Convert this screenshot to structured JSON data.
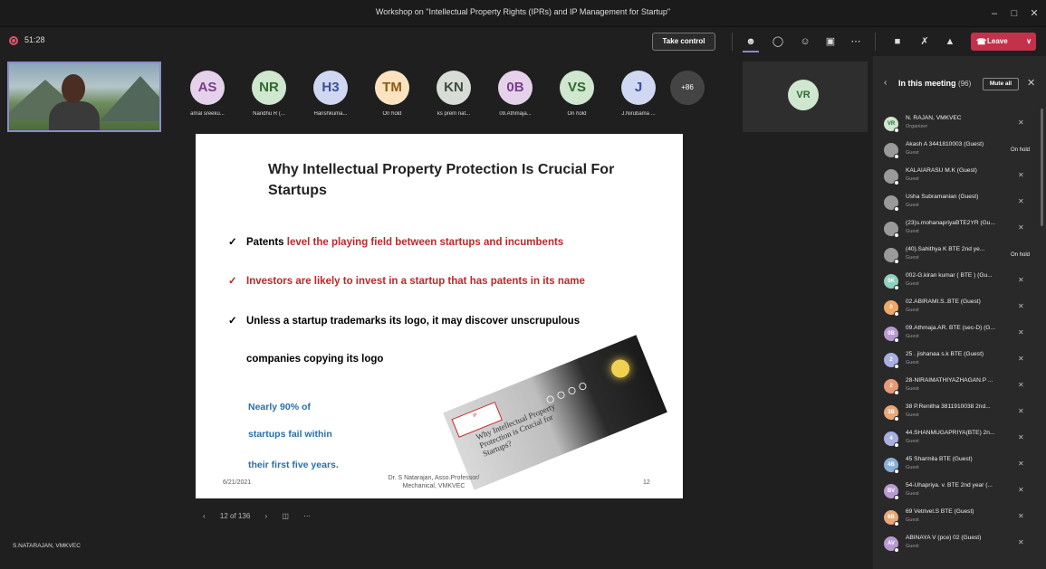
{
  "window": {
    "title": "Workshop on \"Intellectual Property Rights (IPRs) and IP Management for Startup\""
  },
  "toolbar": {
    "timer": "51:28",
    "take_control_label": "Take control",
    "leave_label": "Leave"
  },
  "participants_strip": [
    {
      "initials": "AS",
      "name": "amal sreeku...",
      "bg": "#e5d2ea",
      "fg": "#7a3d8c"
    },
    {
      "initials": "NR",
      "name": "Nandhu R (...",
      "bg": "#cfe6cf",
      "fg": "#2f6a2f"
    },
    {
      "initials": "H3",
      "name": "Harishkuma...",
      "bg": "#cfd8f0",
      "fg": "#3b4f9a"
    },
    {
      "initials": "TM",
      "name": "On hold",
      "bg": "#fbe3c0",
      "fg": "#8a5a12"
    },
    {
      "initials": "KN",
      "name": "ks prem nat...",
      "bg": "#d7dcd7",
      "fg": "#3d4a3d"
    },
    {
      "initials": "0B",
      "name": "09.Athmaja...",
      "bg": "#e5d2ea",
      "fg": "#7a3d8c"
    },
    {
      "initials": "VS",
      "name": "On hold",
      "bg": "#cfe6cf",
      "fg": "#2f6a2f"
    },
    {
      "initials": "J",
      "name": "J.Nirubama ...",
      "bg": "#cfd8f0",
      "fg": "#3b4f9a"
    }
  ],
  "more_count": "+86",
  "vr_tile": {
    "initials": "VR"
  },
  "slide": {
    "title": "Why Intellectual Property Protection Is Crucial For Startups",
    "bullet1_black": "Patents ",
    "bullet1_red": "level the playing field between startups and incumbents",
    "bullet2": "Investors are likely to invest in a startup that has patents in its name",
    "bullet3_line1": "Unless a startup trademarks its logo, it may discover unscrupulous",
    "bullet3_line2": "companies copying its logo",
    "stat_line1": "Nearly 90% of",
    "stat_line2": "startups fail within",
    "stat_line3": "their first five years.",
    "image_text": "Why Intellectual Property Protection is Crucial for Startups?",
    "date": "6/21/2021",
    "footer": "Dr. S Natarajan, Asso.Professor/ Mechanical, VMKVEC",
    "page_number": "12"
  },
  "pager": {
    "text": "12 of 136"
  },
  "presenter_name": "S.NATARAJAN, VMKVEC",
  "panel": {
    "title": "In this meeting",
    "count": "(96)",
    "mute_all_label": "Mute all",
    "people": [
      {
        "initials": "VR",
        "name": "N. RAJAN, VMKVEC",
        "role": "Organizer",
        "bg": "#cfe6cf",
        "fg": "#2f6a2f",
        "status": "mic"
      },
      {
        "initials": "",
        "name": "Akash A 3441810003 (Guest)",
        "role": "Guest",
        "bg": "#9a9a9a",
        "fg": "#fff",
        "status": "On hold"
      },
      {
        "initials": "",
        "name": "KALAIARASU M.K (Guest)",
        "role": "Guest",
        "bg": "#9a9a9a",
        "fg": "#fff",
        "status": "mic"
      },
      {
        "initials": "",
        "name": "Usha Subramanian (Guest)",
        "role": "Guest",
        "bg": "#9a9a9a",
        "fg": "#fff",
        "status": "mic"
      },
      {
        "initials": "",
        "name": "(23)s.mohanapriyaBTE2YR (Gu...",
        "role": "Guest",
        "bg": "#9a9a9a",
        "fg": "#fff",
        "status": "mic"
      },
      {
        "initials": "",
        "name": "(40).Sahithya K BTE 2nd ye...",
        "role": "Guest",
        "bg": "#9a9a9a",
        "fg": "#fff",
        "status": "On hold"
      },
      {
        "initials": "0K",
        "name": "002-G.kiran kumar ( BTE ) (Gu...",
        "role": "Guest",
        "bg": "#8fd0c0",
        "fg": "#fff",
        "status": "mic"
      },
      {
        "initials": "0",
        "name": "02.ABIRAMI.S..BTE (Guest)",
        "role": "Guest",
        "bg": "#f0a868",
        "fg": "#fff",
        "status": "mic"
      },
      {
        "initials": "0B",
        "name": "09.Athmaja.AR. BTE (sec-D) (G...",
        "role": "Guest",
        "bg": "#b89ad0",
        "fg": "#fff",
        "status": "mic"
      },
      {
        "initials": "2",
        "name": "25 . jishanaa s.k BTE (Guest)",
        "role": "Guest",
        "bg": "#a8b0e0",
        "fg": "#fff",
        "status": "mic"
      },
      {
        "initials": "2",
        "name": "28-NIRAIMATHIYAZHAGAN.P ...",
        "role": "Guest",
        "bg": "#e89a78",
        "fg": "#fff",
        "status": "mic"
      },
      {
        "initials": "3B",
        "name": "38 P.Renitha 3811910038 2nd...",
        "role": "Guest",
        "bg": "#e8a878",
        "fg": "#fff",
        "status": "mic"
      },
      {
        "initials": "4",
        "name": "44.SHANMUGAPRIYA(BTE) 2n...",
        "role": "Guest",
        "bg": "#a8b0e0",
        "fg": "#fff",
        "status": "mic"
      },
      {
        "initials": "4B",
        "name": "45 Sharmila BTE (Guest)",
        "role": "Guest",
        "bg": "#8ab0d8",
        "fg": "#fff",
        "status": "mic"
      },
      {
        "initials": "BV",
        "name": "54-Uhapriya. v. BTE 2nd year (...",
        "role": "Guest",
        "bg": "#b89ad0",
        "fg": "#fff",
        "status": "mic"
      },
      {
        "initials": "6B",
        "name": "69 Vetrivel.S BTE (Guest)",
        "role": "Guest",
        "bg": "#e8a878",
        "fg": "#fff",
        "status": "mic"
      },
      {
        "initials": "AV",
        "name": "ABINAYA V (pce) 02 (Guest)",
        "role": "Guest",
        "bg": "#b89ad0",
        "fg": "#fff",
        "status": "mic"
      }
    ]
  }
}
